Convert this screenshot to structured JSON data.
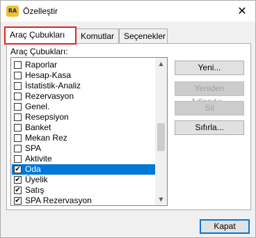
{
  "window": {
    "title": "Özelleştir",
    "app_icon": "RA",
    "close_glyph": "✕"
  },
  "tabs": [
    {
      "label": "Araç Çubukları",
      "active": true
    },
    {
      "label": "Komutlar",
      "active": false
    },
    {
      "label": "Seçenekler",
      "active": false
    }
  ],
  "toolbars_panel": {
    "list_label": "Araç Çubukları:",
    "items": [
      {
        "label": "Raporlar",
        "checked": false,
        "selected": false
      },
      {
        "label": "Hesap-Kasa",
        "checked": false,
        "selected": false
      },
      {
        "label": "İstatistik-Analiz",
        "checked": false,
        "selected": false
      },
      {
        "label": "Rezervasyon",
        "checked": false,
        "selected": false
      },
      {
        "label": "Genel.",
        "checked": false,
        "selected": false
      },
      {
        "label": "Resepsiyon",
        "checked": false,
        "selected": false
      },
      {
        "label": "Banket",
        "checked": false,
        "selected": false
      },
      {
        "label": "Mekan Rez",
        "checked": false,
        "selected": false
      },
      {
        "label": "SPA",
        "checked": false,
        "selected": false
      },
      {
        "label": "Aktivite",
        "checked": false,
        "selected": false
      },
      {
        "label": "Oda",
        "checked": true,
        "selected": true
      },
      {
        "label": "Üyelik",
        "checked": true,
        "selected": false
      },
      {
        "label": "Satış",
        "checked": true,
        "selected": false
      },
      {
        "label": "SPA Rezervasyon",
        "checked": true,
        "selected": false
      }
    ],
    "buttons": {
      "new": "Yeni...",
      "rename": "Yeniden Adlandır...",
      "delete": "Sil",
      "reset": "Sıfırla..."
    }
  },
  "footer": {
    "close_label": "Kapat"
  }
}
